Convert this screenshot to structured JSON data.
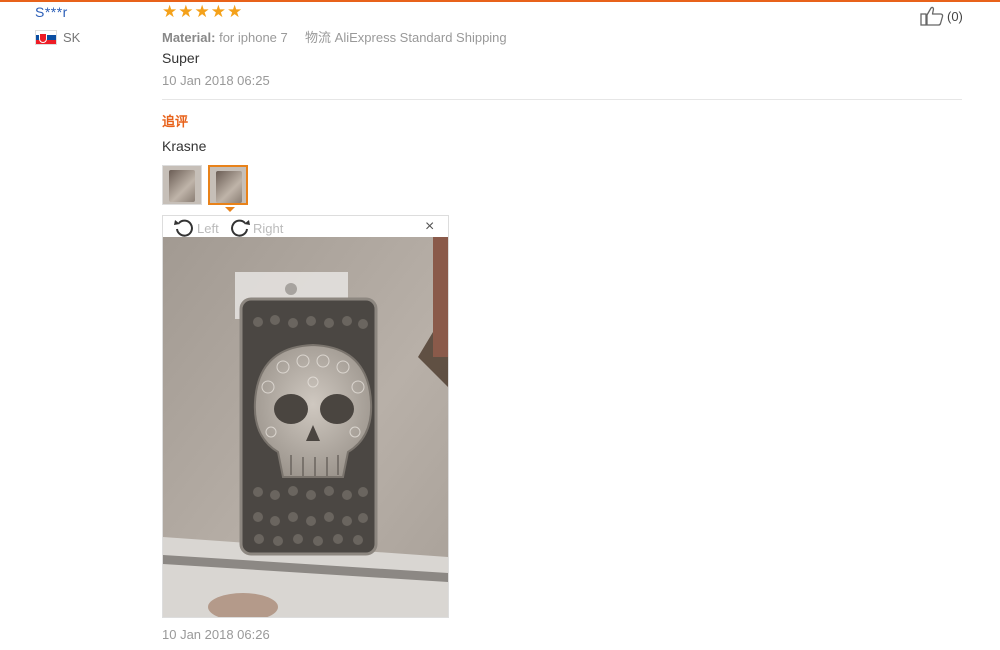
{
  "reviewer": {
    "name": "S***r",
    "country_code": "SK"
  },
  "review": {
    "rating_stars": 5,
    "material_label": "Material:",
    "material_value": "for iphone 7",
    "shipping_label": "物流",
    "shipping_value": "AliExpress Standard Shipping",
    "text": "Super",
    "date": "10 Jan 2018 06:25"
  },
  "helpful": {
    "count_text": "(0)"
  },
  "followup": {
    "heading": "追评",
    "text": "Krasne",
    "thumbnail_count": 2,
    "active_thumbnail": 2,
    "date": "10 Jan 2018 06:26"
  },
  "viewer": {
    "rotate_left_label": "Left",
    "rotate_right_label": "Right",
    "close_glyph": "×"
  },
  "colors": {
    "accent": "#e8621a",
    "star": "#f4a11a",
    "link": "#2c5fb8"
  }
}
